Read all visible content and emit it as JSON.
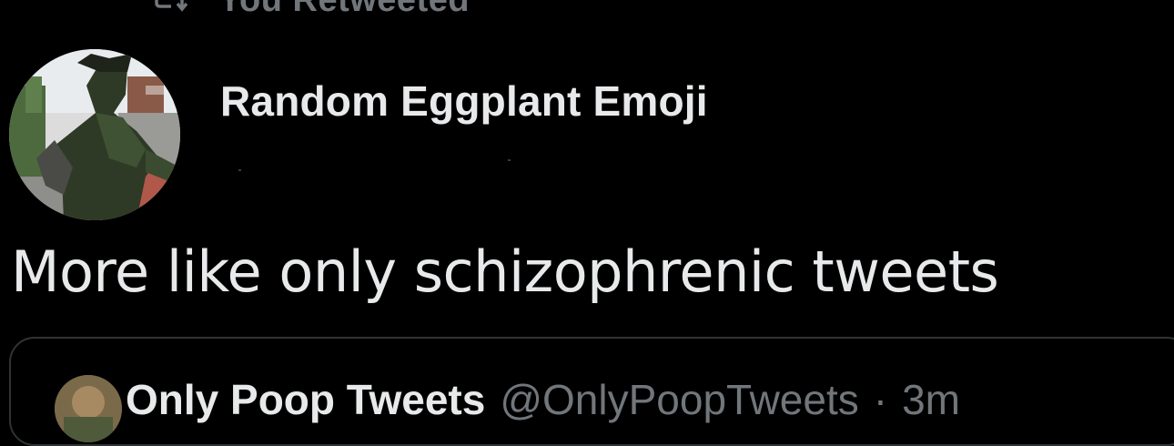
{
  "retweet_banner": {
    "icon": "retweet-icon",
    "label": "You Retweeted"
  },
  "tweet": {
    "author_display_name": "Random Eggplant Emoji",
    "avatar": "statue-photo-avatar",
    "text": "More like only schizophrenic tweets"
  },
  "quoted_tweet": {
    "avatar": "quoted-author-avatar",
    "display_name": "Only Poop Tweets",
    "handle": "@OnlyPoopTweets",
    "separator": "·",
    "time": "3m"
  },
  "colors": {
    "background": "#000000",
    "primary_text": "#e7e9ea",
    "secondary_text": "#71767b",
    "border": "#2f3336"
  }
}
